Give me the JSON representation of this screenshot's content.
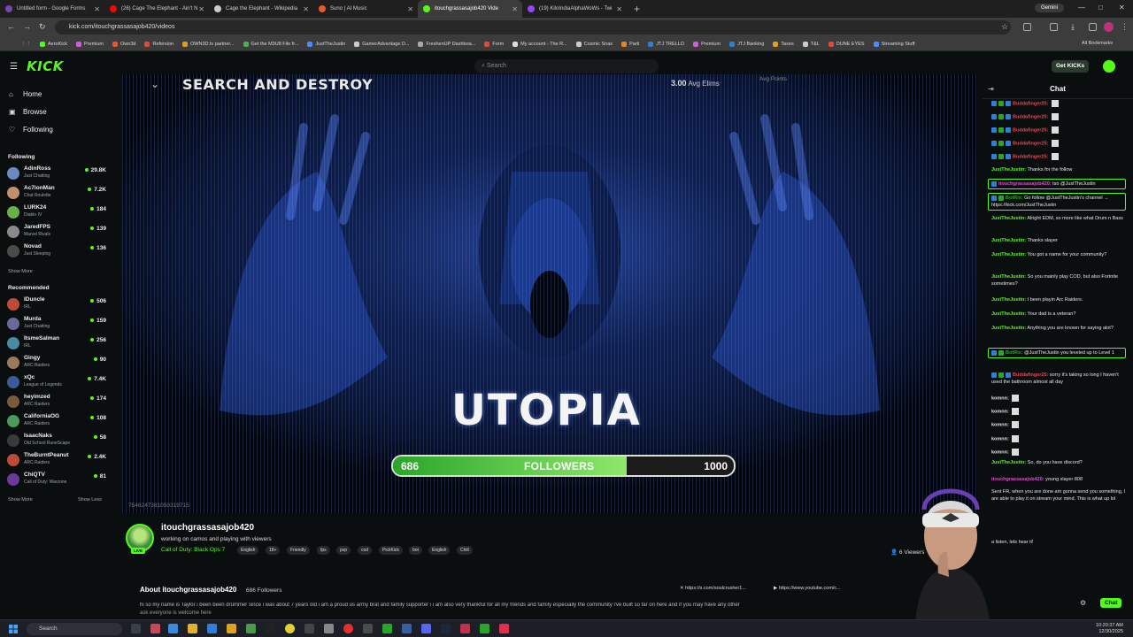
{
  "browser": {
    "tabs": [
      {
        "title": "Untitled form - Google Forms",
        "color": "#7248b9"
      },
      {
        "title": "(26) Cage The Elephant - Ain't N",
        "color": "#ff0000"
      },
      {
        "title": "Cage the Elephant - Wikipedia",
        "color": "#cccccc"
      },
      {
        "title": "Suno | AI Music",
        "color": "#e65a28"
      },
      {
        "title": "itouchgrassasajob420 Vide",
        "color": "#53fc18",
        "active": true
      },
      {
        "title": "(19) KiloIndiaAlphaWoWs - Twi",
        "color": "#9146ff"
      }
    ],
    "gemini": "Gemini",
    "url": "kick.com/itouchgrassasajob420/videos",
    "bookmarks": [
      {
        "label": "AeroKick",
        "color": "#53fc18"
      },
      {
        "label": "Premium",
        "color": "#d05ce3"
      },
      {
        "label": "Own3d",
        "color": "#e65a28"
      },
      {
        "label": "Refersion",
        "color": "#e04a3a"
      },
      {
        "label": "OWN3D.tv partner...",
        "color": "#e09a28"
      },
      {
        "label": "Get the M3U8 File fr...",
        "color": "#4caf50"
      },
      {
        "label": "JustTheJustin",
        "color": "#4a8cff"
      },
      {
        "label": "GamerAdvantage D...",
        "color": "#cccccc"
      },
      {
        "label": "FreshenUP Dashboa...",
        "color": "#aaaaaa"
      },
      {
        "label": "Form",
        "color": "#e04a3a"
      },
      {
        "label": "My account - The R...",
        "color": "#dddddd"
      },
      {
        "label": "Cosmic Snax",
        "color": "#cccccc"
      },
      {
        "label": "Parti",
        "color": "#e0892a"
      },
      {
        "label": "JTJ TRELLO",
        "color": "#2f7fd6"
      },
      {
        "label": "Premium",
        "color": "#d05ce3"
      },
      {
        "label": "JTJ Banking",
        "color": "#2f7fd6"
      },
      {
        "label": "Taxes",
        "color": "#e0a020"
      },
      {
        "label": "T&L",
        "color": "#cccccc"
      },
      {
        "label": "DUNE EYES",
        "color": "#e04a3a"
      },
      {
        "label": "Streaming Stuff",
        "color": "#4a8cff"
      }
    ],
    "all_bookmarks": "All Bookmarks"
  },
  "kick": {
    "logo": "KICK",
    "search_placeholder": "Search",
    "get_kicks": "Get KICKs",
    "accent": "#53fc18"
  },
  "sidebar": {
    "nav": [
      {
        "label": "Home",
        "icon": "home-icon",
        "glyph": "⌂"
      },
      {
        "label": "Browse",
        "icon": "browse-icon",
        "glyph": "▣"
      },
      {
        "label": "Following",
        "icon": "heart-icon",
        "glyph": "♡"
      }
    ],
    "following_title": "Following",
    "following": [
      {
        "name": "AdinRoss",
        "game": "Just Chatting",
        "viewers": "29.8K",
        "color": "#6a8ac0"
      },
      {
        "name": "Ac7ionMan",
        "game": "Chat Roulette",
        "viewers": "7.2K",
        "color": "#c0906a"
      },
      {
        "name": "LURK24",
        "game": "Diablo IV",
        "viewers": "184",
        "color": "#6ab04a"
      },
      {
        "name": "JaredFPS",
        "game": "Marvel Rivals",
        "viewers": "139",
        "color": "#8a8a8a"
      },
      {
        "name": "Novad",
        "game": "Just Sleeping",
        "viewers": "136",
        "color": "#4a4a4a"
      }
    ],
    "show_more": "Show More",
    "recommended_title": "Recommended",
    "recommended": [
      {
        "name": "IDuncle",
        "game": "IRL",
        "viewers": "506",
        "color": "#c04a3a"
      },
      {
        "name": "Murda",
        "game": "Just Chatting",
        "viewers": "159",
        "color": "#6a6a9a"
      },
      {
        "name": "ItsmeSalman",
        "game": "IRL",
        "viewers": "256",
        "color": "#4a8aa0"
      },
      {
        "name": "Gingy",
        "game": "ARC Raiders",
        "viewers": "90",
        "color": "#9a7a5a"
      },
      {
        "name": "xQc",
        "game": "League of Legends",
        "viewers": "7.4K",
        "color": "#3a5a9a"
      },
      {
        "name": "heyimzed",
        "game": "ARC Raiders",
        "viewers": "174",
        "color": "#7a5a3a"
      },
      {
        "name": "CaliforniaOG",
        "game": "ARC Raiders",
        "viewers": "108",
        "color": "#4a9a5a"
      },
      {
        "name": "IsaacNaks",
        "game": "Old School RuneScape",
        "viewers": "58",
        "color": "#3a3a3a"
      },
      {
        "name": "TheBurntPeanut",
        "game": "ARC Raiders",
        "viewers": "2.4K",
        "color": "#c04a3a"
      },
      {
        "name": "ChiQTV",
        "game": "Call of Duty: Warzone",
        "viewers": "81",
        "color": "#6a3a9a"
      }
    ],
    "show_more_2": "Show More",
    "show_less": "Show Less"
  },
  "video": {
    "overlay_title": "SEARCH AND DESTROY",
    "avg_elims_value": "3.00",
    "avg_elims_label": "Avg Elims",
    "avg_points_label": "Avg Points",
    "center_title": "UTOPIA",
    "followers_current": "686",
    "followers_label": "FOLLOWERS",
    "followers_goal": "1000",
    "followers_progress": 0.686,
    "stream_id": "754624738105031971​5"
  },
  "stream": {
    "name": "itouchgrassasajob420",
    "live": "LIVE",
    "title": "working on camos and  playing with viewers",
    "category": "Call of Duty: Black Ops 7",
    "tags": [
      "English",
      "18+",
      "Friendly",
      "fps",
      "pvp",
      "cod",
      "PickKick",
      "bot",
      "English",
      "Chill"
    ],
    "viewers": "6 Viewers",
    "about_title": "About itouchgrassasajob420",
    "about_followers": "686 Followers",
    "social_x": "https://x.com/soulcrusher1...",
    "social_yt": "https://www.youtube.com/c...",
    "bio": "hi so my name is Taylor i been been drummer since i was about 7 years old i am a proud us army brat and family supporter i i am also very thankful for all my friends and family especially the community i've built so far on here and if you may have any other",
    "bio2": "ask everyone is welcome here"
  },
  "chat": {
    "title": "Chat",
    "messages": [
      {
        "user": "Buddafinger25:",
        "text": "",
        "color": "#e04a5a",
        "badges": 3,
        "emote": true
      },
      {
        "user": "Buddafinger25:",
        "text": "",
        "color": "#e04a5a",
        "badges": 3,
        "emote": true
      },
      {
        "user": "Buddafinger25:",
        "text": "",
        "color": "#e04a5a",
        "badges": 3,
        "emote": true
      },
      {
        "user": "Buddafinger25:",
        "text": "",
        "color": "#e04a5a",
        "badges": 3,
        "emote": true
      },
      {
        "user": "Buddafinger25:",
        "text": "",
        "color": "#e04a5a",
        "badges": 3,
        "emote": true
      },
      {
        "user": "JustTheJustin:",
        "text": "Thanks for the follow",
        "color": "#53fc18",
        "badges": 0
      },
      {
        "user": "itouchgrassasajob420:",
        "text": "tso @JustTheJustin",
        "color": "#e04ad0",
        "badges": 1,
        "highlight": true
      },
      {
        "user": "BotRix:",
        "text": "Go follow @JustTheJustin's channel → https://kick.com/JustTheJustin",
        "color": "#2aa52a",
        "badges": 2,
        "highlight": true
      },
      {
        "user": "JustTheJustin:",
        "text": "Alright EDM, so more like what Drum n Bass",
        "color": "#53fc18",
        "badges": 0
      },
      {
        "user": "JustTheJustin:",
        "text": "Thanks slayer",
        "color": "#53fc18",
        "badges": 0
      },
      {
        "user": "JustTheJustin:",
        "text": "You got a name for your community?",
        "color": "#53fc18",
        "badges": 0
      },
      {
        "user": "JustTheJustin:",
        "text": "So you mainly play COD, but also Fortnite sometimes?",
        "color": "#53fc18",
        "badges": 0
      },
      {
        "user": "JustTheJustin:",
        "text": "I been playin Arc Raiders.",
        "color": "#53fc18",
        "badges": 0
      },
      {
        "user": "JustTheJustin:",
        "text": "Your dad is a veteran?",
        "color": "#53fc18",
        "badges": 0
      },
      {
        "user": "JustTheJustin:",
        "text": "Anything you are known for saying alot?",
        "color": "#53fc18",
        "badges": 0
      },
      {
        "user": "BotRix:",
        "text": "@JustTheJustin you leveled up to Level 1",
        "color": "#2aa52a",
        "badges": 2,
        "highlight": true
      },
      {
        "user": "Buddafinger25:",
        "text": "sorry it's taking so long I haven't used the bathroom almost all day",
        "color": "#e04a5a",
        "badges": 3
      },
      {
        "user": "komnn:",
        "text": "",
        "color": "#e6e6e6",
        "badges": 0,
        "emote": true
      },
      {
        "user": "komnn:",
        "text": "",
        "color": "#e6e6e6",
        "badges": 0,
        "emote": true
      },
      {
        "user": "komnn:",
        "text": "",
        "color": "#e6e6e6",
        "badges": 0,
        "emote": true
      },
      {
        "user": "komnn:",
        "text": "",
        "color": "#e6e6e6",
        "badges": 0,
        "emote": true
      },
      {
        "user": "komnn:",
        "text": "",
        "color": "#e6e6e6",
        "badges": 0,
        "emote": true
      },
      {
        "user": "JustTheJustin:",
        "text": "So, do you have discord?",
        "color": "#53fc18",
        "badges": 0
      },
      {
        "user": "itouchgrassasajob420:",
        "text": "young slayer 808",
        "color": "#e04ad0",
        "badges": 0
      },
      {
        "user": "",
        "text": "Sent FR, when you are done am gonna send you something, I are able to play it on stream your mind. This is what up lol",
        "color": "#e6e6e6",
        "badges": 0
      },
      {
        "user": "",
        "text": "a listen, lets hear it!",
        "color": "#e6e6e6",
        "badges": 0
      }
    ],
    "chat_button": "Chat"
  },
  "taskbar": {
    "search": "Search",
    "time": "10:20:37 AM",
    "date": "12/30/2025"
  }
}
